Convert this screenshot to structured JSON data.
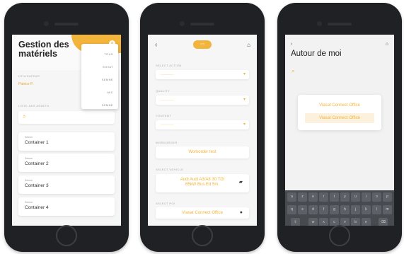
{
  "phone1": {
    "title": "Gestion des matériels",
    "close_icon": "×",
    "user_label": "UTILISATEUR",
    "user_name": "Patrice P.",
    "list_label": "LISTE DES ASSETS",
    "search_icon": "⌕",
    "menu": [
      "TOUS",
      "SOVAT",
      "SEMNE",
      "MIC",
      "SEMNE"
    ],
    "assets": [
      {
        "type": "Semne",
        "name": "Container 1"
      },
      {
        "type": "Semne",
        "name": "Container 2"
      },
      {
        "type": "Semne",
        "name": "Container 3"
      },
      {
        "type": "Semne",
        "name": "Container 4"
      }
    ]
  },
  "phone2": {
    "back_icon": "‹",
    "pill_icon": "▭",
    "home_icon": "⌂",
    "select_action_label": "SELECT ACTION",
    "quality_label": "QUALITY",
    "content_label": "CONTENT",
    "select_placeholder": "--------------",
    "chevron": "▾",
    "workorder_label": "WORKORDER",
    "workorder_value": "Workorder test",
    "vehicle_label": "SELECT VEHICLE",
    "vehicle_value_line1": "Audi Audi A3/A8 30 TDI",
    "vehicle_value_line2": "85kW Bus.Ed 5m.",
    "vehicle_icon": "▰",
    "poi_label": "SELECT POI",
    "poi_value": "Viasat Connect Office",
    "poi_icon": "●"
  },
  "phone3": {
    "back_icon": "‹",
    "home_icon": "⌂",
    "title": "Autour de moi",
    "search_icon": "⌕",
    "results": [
      "Viasat Connect Office",
      "Viasat Connect Office"
    ],
    "keyboard_row1": [
      "a",
      "z",
      "e",
      "r",
      "t",
      "y",
      "u",
      "i",
      "o",
      "p"
    ],
    "keyboard_row2": [
      "q",
      "s",
      "d",
      "f",
      "g",
      "h",
      "j",
      "k",
      "l",
      "m"
    ],
    "keyboard_row3": [
      "⇧",
      "w",
      "x",
      "c",
      "v",
      "b",
      "n",
      "⌫"
    ]
  },
  "colors": {
    "accent": "#f2b43a",
    "phone_body": "#1f2124",
    "keyboard": "#474a4f"
  }
}
